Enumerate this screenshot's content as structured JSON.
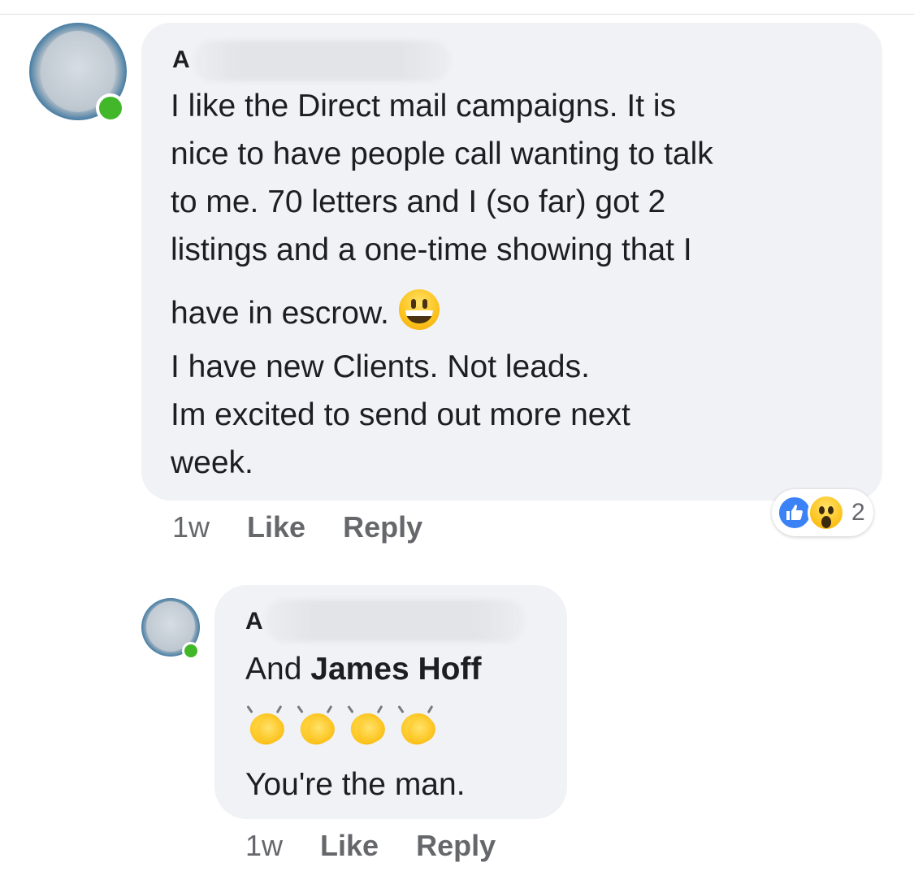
{
  "comment": {
    "author_initial": "A",
    "text_lines": [
      "I like the Direct mail campaigns. It is",
      "nice to have people call wanting to talk",
      "to me. 70 letters and I (so far) got 2",
      "listings and a one-time showing that I",
      "have in escrow.",
      "I have new Clients. Not leads.",
      "Im excited to send out more next",
      "week."
    ],
    "inline_emoji": "grinning-face-icon",
    "time": "1w",
    "like_label": "Like",
    "reply_label": "Reply",
    "reactions": {
      "types": [
        "like-icon",
        "wow-icon"
      ],
      "count": "2",
      "like_color": "#3b82f6"
    }
  },
  "reply": {
    "author_initial": "A",
    "lead_text": "And",
    "mention": "James Hoff",
    "emoji_row": [
      "clapping-hands-icon",
      "clapping-hands-icon",
      "clapping-hands-icon",
      "clapping-hands-icon"
    ],
    "closing_text": "You're the man.",
    "time": "1w",
    "like_label": "Like",
    "reply_label": "Reply"
  },
  "colors": {
    "bubble": "#f0f2f5",
    "online": "#42b72a",
    "meta_text": "#65676b"
  }
}
